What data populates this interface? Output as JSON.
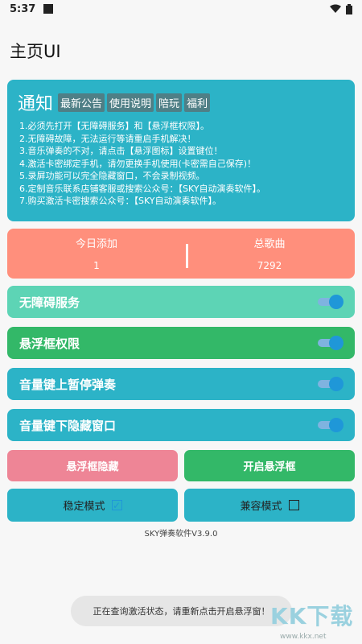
{
  "status": {
    "time": "5:37"
  },
  "header": {
    "title": "主页UI"
  },
  "notice": {
    "title": "通知",
    "tags": [
      "最新公告",
      "使用说明",
      "陪玩",
      "福利"
    ],
    "lines": [
      "1.必须先打开【无障碍服务】和【悬浮框权限】。",
      "2.无障碍故障，无法运行等请重启手机解决！",
      "3.音乐弹奏的不对，请点击【悬浮图标】设置键位！",
      "4.激活卡密绑定手机，请勿更换手机使用(卡密需自己保存)！",
      "5.录屏功能可以完全隐藏窗口，不会录制视频。",
      "6.定制音乐联系店铺客服或搜索公众号：【SKY自动演奏软件】。",
      "7.购买激活卡密搜索公众号：【SKY自动演奏软件】。"
    ]
  },
  "stats": {
    "today_label": "今日添加",
    "today_value": "1",
    "total_label": "总歌曲",
    "total_value": "7292"
  },
  "toggles": [
    {
      "label": "无障碍服务",
      "color": "#5dd4b5"
    },
    {
      "label": "悬浮框权限",
      "color": "#33b868"
    },
    {
      "label": "音量键上暂停弹奏",
      "color": "#2cb3c7"
    },
    {
      "label": "音量键下隐藏窗口",
      "color": "#2cb3c7"
    }
  ],
  "buttons": {
    "hide_float": "悬浮框隐藏",
    "open_float": "开启悬浮框"
  },
  "modes": {
    "stable": "稳定模式",
    "compat": "兼容模式"
  },
  "version": "SKY弹奏软件V3.9.0",
  "toast": "正在查询激活状态，请重新点击开启悬浮窗！",
  "watermark": {
    "text": "KK下载",
    "url": "www.kkx.net"
  },
  "colors": {
    "accent": "#2cb3c7",
    "stats": "#ff8f7c",
    "hide": "#ee8596",
    "open": "#33b868"
  }
}
